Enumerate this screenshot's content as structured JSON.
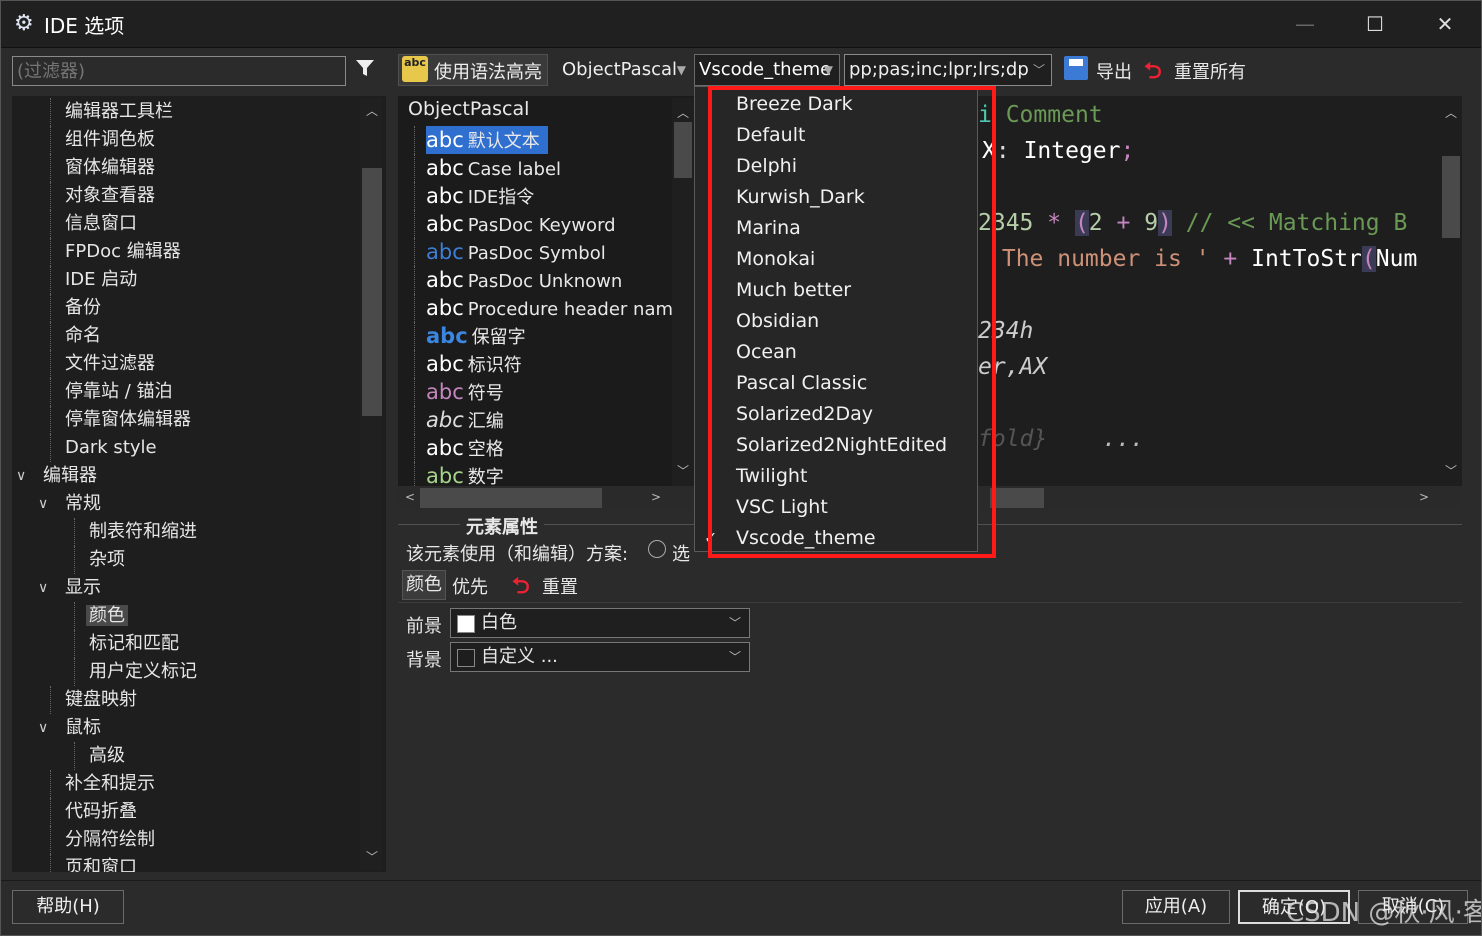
{
  "window": {
    "title": "IDE 选项",
    "icon": "gear-icon",
    "controls": {
      "minimize": "—",
      "maximize": "☐",
      "close": "✕"
    }
  },
  "sidebar": {
    "filter_placeholder": "(过滤器)",
    "items": [
      {
        "label": "编辑器工具栏",
        "level": 1
      },
      {
        "label": "组件调色板",
        "level": 1
      },
      {
        "label": "窗体编辑器",
        "level": 1
      },
      {
        "label": "对象查看器",
        "level": 1
      },
      {
        "label": "信息窗口",
        "level": 1
      },
      {
        "label": "FPDoc 编辑器",
        "level": 1
      },
      {
        "label": "IDE 启动",
        "level": 1
      },
      {
        "label": "备份",
        "level": 1
      },
      {
        "label": "命名",
        "level": 1
      },
      {
        "label": "文件过滤器",
        "level": 1
      },
      {
        "label": "停靠站 / 锚泊",
        "level": 1
      },
      {
        "label": "停靠窗体编辑器",
        "level": 1
      },
      {
        "label": "Dark style",
        "level": 1
      },
      {
        "label": "编辑器",
        "level": 0,
        "expanded": true
      },
      {
        "label": "常规",
        "level": 1,
        "expanded": true
      },
      {
        "label": "制表符和缩进",
        "level": 2
      },
      {
        "label": "杂项",
        "level": 2
      },
      {
        "label": "显示",
        "level": 1,
        "expanded": true
      },
      {
        "label": "颜色",
        "level": 2,
        "selected": true
      },
      {
        "label": "标记和匹配",
        "level": 2
      },
      {
        "label": "用户定义标记",
        "level": 2
      },
      {
        "label": "键盘映射",
        "level": 1
      },
      {
        "label": "鼠标",
        "level": 1,
        "expanded": true
      },
      {
        "label": "高级",
        "level": 2
      },
      {
        "label": "补全和提示",
        "level": 1
      },
      {
        "label": "代码折叠",
        "level": 1
      },
      {
        "label": "分隔符绘制",
        "level": 1
      },
      {
        "label": "页和窗口",
        "level": 1
      }
    ]
  },
  "toolbar": {
    "syntax_highlight_label": "使用语法高亮",
    "syntax_icon_text": "abc",
    "language": "ObjectPascal",
    "scheme": "Vscode_theme",
    "extensions": "pp;pas;inc;lpr;lrs;dpr;",
    "export_label": "导出",
    "reset_all_label": "重置所有"
  },
  "elements": {
    "language_root": "ObjectPascal",
    "items": [
      {
        "abc": "abc",
        "label": "默认文本",
        "color": "#ffffff",
        "selected": true
      },
      {
        "abc": "abc",
        "label": "Case label",
        "color": "#ffffff"
      },
      {
        "abc": "abc",
        "label": "IDE指令",
        "color": "#ffffff"
      },
      {
        "abc": "abc",
        "label": "PasDoc Keyword",
        "color": "#ffffff"
      },
      {
        "abc": "abc",
        "label": "PasDoc Symbol",
        "color": "#3d7fd6"
      },
      {
        "abc": "abc",
        "label": "PasDoc Unknown",
        "color": "#ffffff"
      },
      {
        "abc": "abc",
        "label": "Procedure header name",
        "color": "#ffffff"
      },
      {
        "abc": "abc",
        "label": "保留字",
        "color": "#3a86e0",
        "bold": true
      },
      {
        "abc": "abc",
        "label": "标识符",
        "color": "#ffffff"
      },
      {
        "abc": "abc",
        "label": "符号",
        "color": "#c586c0"
      },
      {
        "abc": "abc",
        "label": "汇编",
        "color": "#dddddd",
        "italic": true
      },
      {
        "abc": "abc",
        "label": "空格",
        "color": "#ffffff"
      },
      {
        "abc": "abc",
        "label": "数字",
        "color": "#a6d48a"
      }
    ]
  },
  "preview": {
    "lines": [
      [
        {
          "t": "i ",
          "c": "#4ec9b0"
        },
        {
          "t": "Comment",
          "c": "#6a9955"
        }
      ],
      [
        {
          "t": "X",
          "c": "#ffffff"
        },
        {
          "t": ": ",
          "c": "#dddddd"
        },
        {
          "t": "Integer",
          "c": "#ffffff"
        },
        {
          "t": ";",
          "c": "#c586c0"
        }
      ],
      [
        {
          "t": "2345",
          "c": "#b5cea8"
        },
        {
          "t": " * ",
          "c": "#c586c0"
        },
        {
          "t": "(",
          "c": "#c586c0"
        },
        {
          "t": "2",
          "c": "#b5cea8"
        },
        {
          "t": " + ",
          "c": "#c586c0"
        },
        {
          "t": "9",
          "c": "#b5cea8"
        },
        {
          "t": ")",
          "c": "#c586c0"
        },
        {
          "t": " // << Matching B",
          "c": "#6a9955"
        }
      ],
      [
        {
          "t": "'The number is '",
          "c": "#ce9178"
        },
        {
          "t": " + ",
          "c": "#c586c0"
        },
        {
          "t": "IntToStr",
          "c": "#ffffff"
        },
        {
          "t": "(",
          "c": "#c586c0"
        },
        {
          "t": "Num",
          "c": "#ffffff"
        }
      ],
      [
        {
          "t": "234h",
          "c": "#cccccc"
        }
      ],
      [
        {
          "t": "er,AX",
          "c": "#cccccc"
        }
      ],
      [
        {
          "t": "fold}",
          "c": "#555555"
        },
        {
          "t": "    ...",
          "c": "#bbbbbb"
        }
      ]
    ]
  },
  "scheme_dropdown": {
    "options": [
      "Breeze Dark",
      "Default",
      "Delphi",
      "Kurwish_Dark",
      "Marina",
      "Monokai",
      "Much better",
      "Obsidian",
      "Ocean",
      "Pascal Classic",
      "Solarized2Day",
      "Solarized2NightEdited",
      "Twilight",
      "VSC Light",
      "Vscode_theme"
    ],
    "checked": "Vscode_theme",
    "highlight_color": "#ff1a1a"
  },
  "attributes": {
    "title": "元素属性",
    "scheme_use_label": "该元素使用（和编辑）方案:",
    "radio_label": "选",
    "tab_color": "颜色",
    "tab_priority": "优先",
    "reset_label": "重置",
    "foreground_label": "前景",
    "foreground_value": "白色",
    "foreground_swatch": "#ffffff",
    "background_label": "背景",
    "background_value": "自定义 ...",
    "background_swatch": "#1e1e1e"
  },
  "buttons": {
    "help": "帮助(H)",
    "apply": "应用(A)",
    "ok": "确定(O)",
    "cancel": "取消(C)"
  },
  "watermark": "CSDN @秋·风·客"
}
